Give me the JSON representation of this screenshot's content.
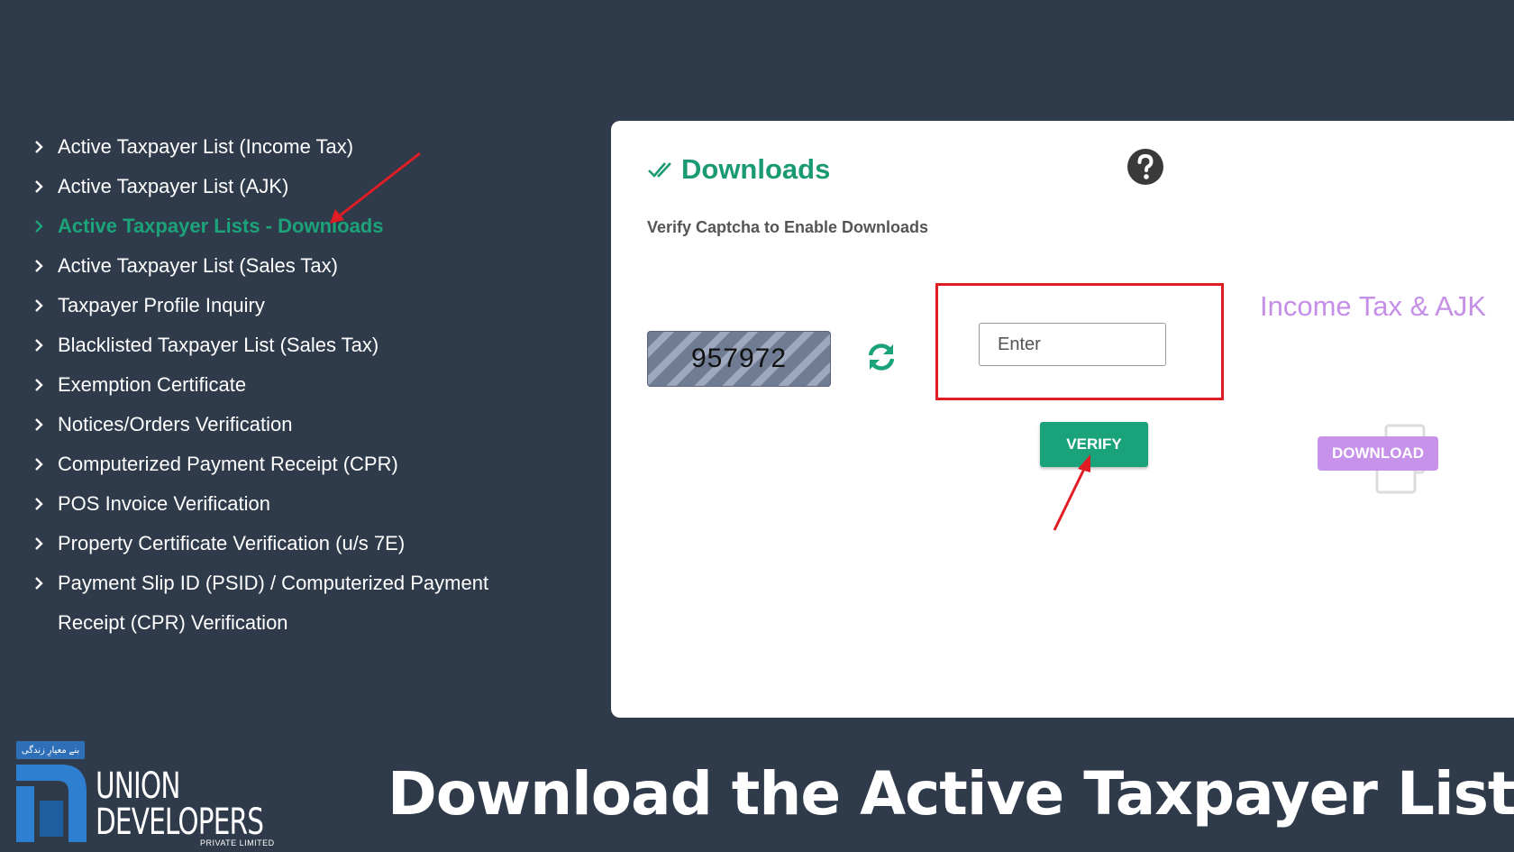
{
  "sidebar": {
    "items": [
      {
        "label": "Active Taxpayer List (Income Tax)"
      },
      {
        "label": "Active Taxpayer List (AJK)"
      },
      {
        "label": "Active Taxpayer Lists - Downloads"
      },
      {
        "label": "Active Taxpayer List (Sales Tax)"
      },
      {
        "label": "Taxpayer Profile Inquiry"
      },
      {
        "label": "Blacklisted Taxpayer List (Sales Tax)"
      },
      {
        "label": "Exemption Certificate"
      },
      {
        "label": "Notices/Orders Verification"
      },
      {
        "label": "Computerized Payment Receipt (CPR)"
      },
      {
        "label": "POS Invoice Verification"
      },
      {
        "label": "Property Certificate Verification (u/s 7E)"
      },
      {
        "label": "Payment Slip ID (PSID) / Computerized Payment Receipt (CPR) Verification"
      }
    ],
    "active_index": 2
  },
  "downloads": {
    "title": "Downloads",
    "subtitle": "Verify Captcha to Enable Downloads",
    "captcha_code": "957972",
    "input_placeholder": "Enter",
    "verify_label": "VERIFY",
    "section_label": "Income Tax & AJK",
    "download_label": "DOWNLOAD"
  },
  "branding": {
    "tagline": "بنے معیارِ زندگی",
    "name_line1": "UNION",
    "name_line2": "DEVELOPERS",
    "sub": "PRIVATE LIMITED"
  },
  "headline": "Download the Active Taxpayer List",
  "colors": {
    "background": "#2f3a4a",
    "accent_green": "#1aa37a",
    "highlight_red": "#e01c24",
    "download_purple": "#c792ea"
  }
}
